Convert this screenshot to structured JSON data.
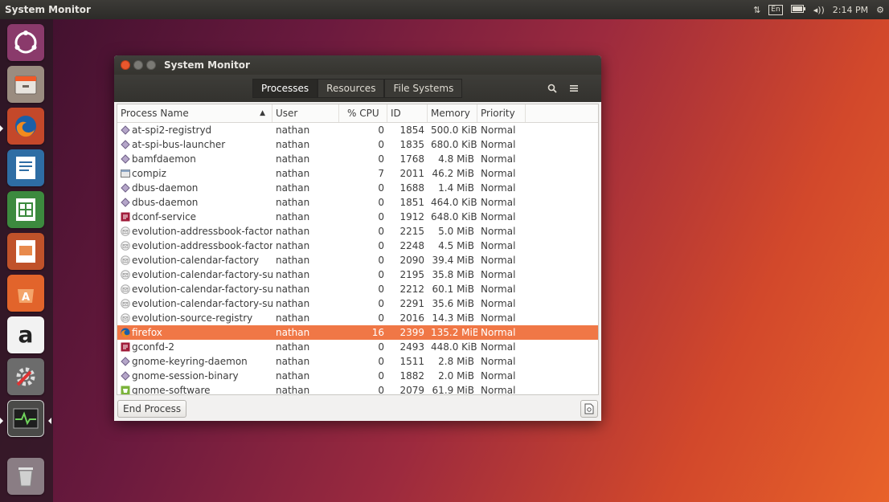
{
  "topbar": {
    "app_title": "System Monitor",
    "keyboard_layout": "En",
    "volume_icon": "◂))",
    "clock": "2:14 PM"
  },
  "launcher": {
    "items": [
      {
        "name": "dash-home",
        "icon": "ubuntu-logo-icon"
      },
      {
        "name": "files",
        "icon": "file-cabinet-icon"
      },
      {
        "name": "firefox",
        "icon": "firefox-icon"
      },
      {
        "name": "libreoffice-writer",
        "icon": "writer-icon"
      },
      {
        "name": "libreoffice-calc",
        "icon": "calc-icon"
      },
      {
        "name": "libreoffice-impress",
        "icon": "impress-icon"
      },
      {
        "name": "ubuntu-software",
        "icon": "software-center-icon"
      },
      {
        "name": "amazon",
        "icon": "amazon-icon",
        "label": "a"
      },
      {
        "name": "system-settings",
        "icon": "settings-icon"
      },
      {
        "name": "system-monitor",
        "icon": "system-monitor-icon"
      },
      {
        "name": "trash",
        "icon": "trash-icon"
      }
    ]
  },
  "window": {
    "title": "System Monitor",
    "tabs": [
      {
        "label": "Processes",
        "active": true
      },
      {
        "label": "Resources",
        "active": false
      },
      {
        "label": "File Systems",
        "active": false
      }
    ],
    "columns": {
      "name": "Process Name",
      "user": "User",
      "cpu": "% CPU",
      "id": "ID",
      "memory": "Memory",
      "priority": "Priority"
    },
    "sort_indicator": "▲",
    "processes": [
      {
        "name": "at-spi2-registryd",
        "user": "nathan",
        "cpu": "0",
        "id": "1854",
        "memory": "500.0 KiB",
        "priority": "Normal",
        "icon": "diamond"
      },
      {
        "name": "at-spi-bus-launcher",
        "user": "nathan",
        "cpu": "0",
        "id": "1835",
        "memory": "680.0 KiB",
        "priority": "Normal",
        "icon": "diamond"
      },
      {
        "name": "bamfdaemon",
        "user": "nathan",
        "cpu": "0",
        "id": "1768",
        "memory": "4.8 MiB",
        "priority": "Normal",
        "icon": "diamond"
      },
      {
        "name": "compiz",
        "user": "nathan",
        "cpu": "7",
        "id": "2011",
        "memory": "46.2 MiB",
        "priority": "Normal",
        "icon": "window"
      },
      {
        "name": "dbus-daemon",
        "user": "nathan",
        "cpu": "0",
        "id": "1688",
        "memory": "1.4 MiB",
        "priority": "Normal",
        "icon": "diamond"
      },
      {
        "name": "dbus-daemon",
        "user": "nathan",
        "cpu": "0",
        "id": "1851",
        "memory": "464.0 KiB",
        "priority": "Normal",
        "icon": "diamond"
      },
      {
        "name": "dconf-service",
        "user": "nathan",
        "cpu": "0",
        "id": "1912",
        "memory": "648.0 KiB",
        "priority": "Normal",
        "icon": "dconf"
      },
      {
        "name": "evolution-addressbook-factor",
        "user": "nathan",
        "cpu": "0",
        "id": "2215",
        "memory": "5.0 MiB",
        "priority": "Normal",
        "icon": "envelope"
      },
      {
        "name": "evolution-addressbook-factor",
        "user": "nathan",
        "cpu": "0",
        "id": "2248",
        "memory": "4.5 MiB",
        "priority": "Normal",
        "icon": "envelope"
      },
      {
        "name": "evolution-calendar-factory",
        "user": "nathan",
        "cpu": "0",
        "id": "2090",
        "memory": "39.4 MiB",
        "priority": "Normal",
        "icon": "envelope"
      },
      {
        "name": "evolution-calendar-factory-sul",
        "user": "nathan",
        "cpu": "0",
        "id": "2195",
        "memory": "35.8 MiB",
        "priority": "Normal",
        "icon": "envelope"
      },
      {
        "name": "evolution-calendar-factory-sul",
        "user": "nathan",
        "cpu": "0",
        "id": "2212",
        "memory": "60.1 MiB",
        "priority": "Normal",
        "icon": "envelope"
      },
      {
        "name": "evolution-calendar-factory-sul",
        "user": "nathan",
        "cpu": "0",
        "id": "2291",
        "memory": "35.6 MiB",
        "priority": "Normal",
        "icon": "envelope"
      },
      {
        "name": "evolution-source-registry",
        "user": "nathan",
        "cpu": "0",
        "id": "2016",
        "memory": "14.3 MiB",
        "priority": "Normal",
        "icon": "envelope"
      },
      {
        "name": "firefox",
        "user": "nathan",
        "cpu": "16",
        "id": "2399",
        "memory": "135.2 MiB",
        "priority": "Normal",
        "icon": "firefox",
        "selected": true
      },
      {
        "name": "gconfd-2",
        "user": "nathan",
        "cpu": "0",
        "id": "2493",
        "memory": "448.0 KiB",
        "priority": "Normal",
        "icon": "dconf"
      },
      {
        "name": "gnome-keyring-daemon",
        "user": "nathan",
        "cpu": "0",
        "id": "1511",
        "memory": "2.8 MiB",
        "priority": "Normal",
        "icon": "diamond"
      },
      {
        "name": "gnome-session-binary",
        "user": "nathan",
        "cpu": "0",
        "id": "1882",
        "memory": "2.0 MiB",
        "priority": "Normal",
        "icon": "diamond"
      },
      {
        "name": "gnome-software",
        "user": "nathan",
        "cpu": "0",
        "id": "2079",
        "memory": "61.9 MiB",
        "priority": "Normal",
        "icon": "software"
      }
    ],
    "end_process_label": "End Process"
  },
  "colors": {
    "selection": "#f07746",
    "close_button": "#e9572d",
    "titlebar": "#3c3b37"
  }
}
